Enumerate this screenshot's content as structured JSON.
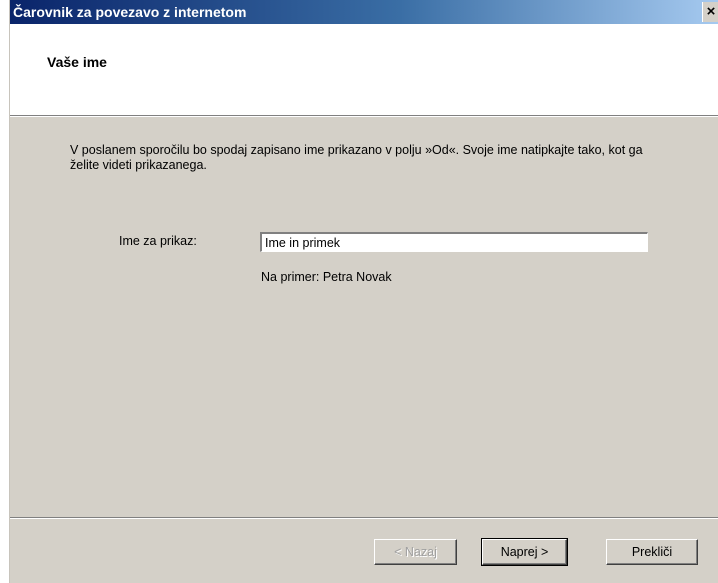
{
  "window": {
    "title": "Čarovnik za povezavo z internetom",
    "close_glyph": "×"
  },
  "header": {
    "title": "Vaše ime"
  },
  "main": {
    "description": "V poslanem sporočilu bo spodaj zapisano ime prikazano v polju »Od«. Svoje ime natipkajte tako, kot ga želite videti prikazanega.",
    "name_label": "Ime za prikaz:",
    "name_value": "Ime in primek",
    "example": "Na primer: Petra Novak"
  },
  "buttons": {
    "back": "< Nazaj",
    "next": "Naprej >",
    "cancel": "Prekliči"
  },
  "colors": {
    "titlebar_start": "#0a246a",
    "titlebar_end": "#a6caf0",
    "dialog_face": "#d4d0c8"
  },
  "icons": {
    "close": "close-icon"
  }
}
